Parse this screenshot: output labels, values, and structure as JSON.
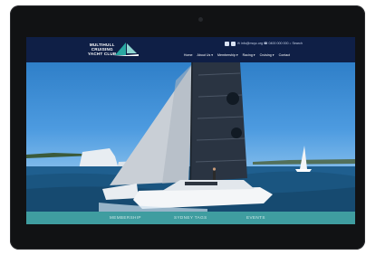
{
  "site": {
    "logo_lines": [
      "MULTIHULL",
      "CRUISING",
      "YACHT CLUB"
    ],
    "contact_line": "✉ info@mcyc.org  ☎ 0400 000 000  ⌕ Search",
    "social_icons": [
      "facebook-icon",
      "instagram-icon"
    ]
  },
  "nav": {
    "items": [
      "Home",
      "About Us ▾",
      "Membership ▾",
      "Racing ▾",
      "Cruising ▾",
      "Contact"
    ]
  },
  "bottom_nav": {
    "items": [
      "MEMBERSHIP",
      "SYDNEY TAGS",
      "EVENTS"
    ]
  },
  "colors": {
    "header": "#0f1f46",
    "accent_teal": "#3f9da0",
    "logo_teal": "#2aa8a2"
  }
}
